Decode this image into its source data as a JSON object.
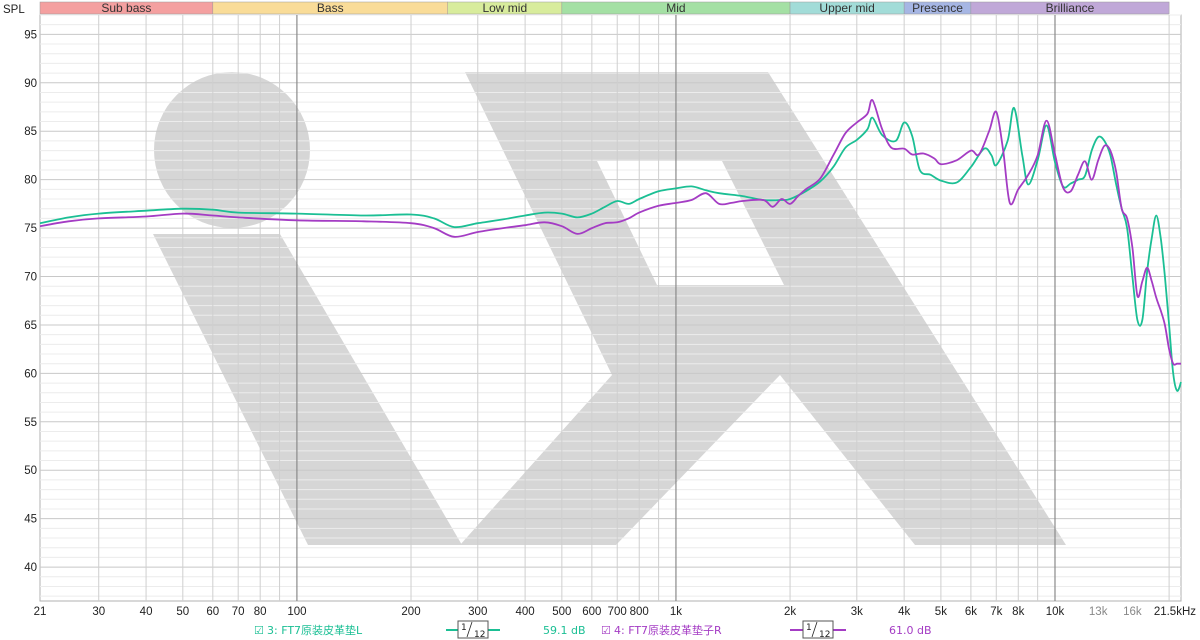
{
  "chart_data": {
    "type": "line",
    "ylabel": "SPL",
    "x_unit": "Hz",
    "ylim": [
      36.5,
      97
    ],
    "xlim": [
      21,
      21500
    ],
    "log_x": true,
    "grid": true,
    "y_ticks": [
      95,
      90,
      85,
      80,
      75,
      70,
      65,
      60,
      55,
      50,
      45,
      40
    ],
    "x_ticks": [
      {
        "v": 21,
        "label": "21"
      },
      {
        "v": 30,
        "label": "30"
      },
      {
        "v": 40,
        "label": "40"
      },
      {
        "v": 50,
        "label": "50"
      },
      {
        "v": 60,
        "label": "60"
      },
      {
        "v": 70,
        "label": "70"
      },
      {
        "v": 80,
        "label": "80"
      },
      {
        "v": 100,
        "label": "100"
      },
      {
        "v": 200,
        "label": "200"
      },
      {
        "v": 300,
        "label": "300"
      },
      {
        "v": 400,
        "label": "400"
      },
      {
        "v": 500,
        "label": "500"
      },
      {
        "v": 600,
        "label": "600"
      },
      {
        "v": 700,
        "label": "700"
      },
      {
        "v": 800,
        "label": "800"
      },
      {
        "v": 1000,
        "label": "1k"
      },
      {
        "v": 2000,
        "label": "2k"
      },
      {
        "v": 3000,
        "label": "3k"
      },
      {
        "v": 4000,
        "label": "4k"
      },
      {
        "v": 5000,
        "label": "5k"
      },
      {
        "v": 6000,
        "label": "6k"
      },
      {
        "v": 7000,
        "label": "7k"
      },
      {
        "v": 8000,
        "label": "8k"
      },
      {
        "v": 10000,
        "label": "10k"
      },
      {
        "v": 13000,
        "label": "13k",
        "dim": true
      },
      {
        "v": 16000,
        "label": "16k",
        "dim": true
      },
      {
        "v": 21500,
        "label": "21.5kHz"
      }
    ],
    "bands": [
      {
        "name": "Sub bass",
        "from": 21,
        "to": 60,
        "color": "#f4a0a0"
      },
      {
        "name": "Bass",
        "from": 60,
        "to": 250,
        "color": "#f9dc98"
      },
      {
        "name": "Low mid",
        "from": 250,
        "to": 500,
        "color": "#d8ec9c"
      },
      {
        "name": "Mid",
        "from": 500,
        "to": 2000,
        "color": "#a4e0a4"
      },
      {
        "name": "Upper mid",
        "from": 2000,
        "to": 4000,
        "color": "#a2dcd8"
      },
      {
        "name": "Presence",
        "from": 4000,
        "to": 6000,
        "color": "#a6b6e4"
      },
      {
        "name": "Brilliance",
        "from": 6000,
        "to": 20000,
        "color": "#c0a8d8"
      }
    ],
    "series": [
      {
        "name": "3: FT7原装皮革垫L",
        "color": "#1bbf94",
        "smoothing": "1/12",
        "level": "59.1 dB",
        "points": [
          [
            21,
            75.5
          ],
          [
            25,
            76.1
          ],
          [
            30,
            76.5
          ],
          [
            40,
            76.8
          ],
          [
            50,
            77.0
          ],
          [
            60,
            76.9
          ],
          [
            70,
            76.6
          ],
          [
            100,
            76.5
          ],
          [
            150,
            76.3
          ],
          [
            200,
            76.4
          ],
          [
            230,
            76.0
          ],
          [
            260,
            75.1
          ],
          [
            300,
            75.5
          ],
          [
            350,
            75.9
          ],
          [
            400,
            76.3
          ],
          [
            450,
            76.6
          ],
          [
            500,
            76.5
          ],
          [
            550,
            76.1
          ],
          [
            600,
            76.5
          ],
          [
            650,
            77.2
          ],
          [
            700,
            77.8
          ],
          [
            750,
            77.5
          ],
          [
            800,
            78.0
          ],
          [
            900,
            78.8
          ],
          [
            1000,
            79.1
          ],
          [
            1100,
            79.3
          ],
          [
            1200,
            78.9
          ],
          [
            1300,
            78.6
          ],
          [
            1500,
            78.3
          ],
          [
            1700,
            77.9
          ],
          [
            1900,
            77.9
          ],
          [
            2000,
            78.0
          ],
          [
            2200,
            78.8
          ],
          [
            2400,
            79.8
          ],
          [
            2600,
            81.3
          ],
          [
            2800,
            83.3
          ],
          [
            3000,
            84.1
          ],
          [
            3200,
            85.2
          ],
          [
            3300,
            86.4
          ],
          [
            3500,
            84.6
          ],
          [
            3800,
            84.0
          ],
          [
            4000,
            85.9
          ],
          [
            4200,
            84.5
          ],
          [
            4400,
            81.0
          ],
          [
            4700,
            80.5
          ],
          [
            5000,
            79.9
          ],
          [
            5500,
            79.7
          ],
          [
            6000,
            81.3
          ],
          [
            6500,
            83.2
          ],
          [
            6800,
            82.5
          ],
          [
            7000,
            81.5
          ],
          [
            7500,
            84.0
          ],
          [
            7800,
            87.4
          ],
          [
            8200,
            82.5
          ],
          [
            8500,
            79.5
          ],
          [
            9000,
            82.0
          ],
          [
            9500,
            85.6
          ],
          [
            10000,
            81.8
          ],
          [
            10500,
            79.3
          ],
          [
            11000,
            79.6
          ],
          [
            11500,
            80.0
          ],
          [
            12000,
            80.4
          ],
          [
            12500,
            83.0
          ],
          [
            13000,
            84.4
          ],
          [
            13500,
            84.0
          ],
          [
            14000,
            82.5
          ],
          [
            14500,
            79.5
          ],
          [
            15000,
            77.0
          ],
          [
            15500,
            75.0
          ],
          [
            16000,
            70.0
          ],
          [
            16500,
            65.5
          ],
          [
            17000,
            65.5
          ],
          [
            17500,
            70.5
          ],
          [
            18000,
            74.0
          ],
          [
            18500,
            76.3
          ],
          [
            19000,
            74.0
          ],
          [
            19500,
            70.0
          ],
          [
            20000,
            65.0
          ],
          [
            20500,
            60.0
          ],
          [
            21000,
            58.2
          ],
          [
            21500,
            59.1
          ]
        ]
      },
      {
        "name": "4: FT7原装皮革垫子R",
        "color": "#a43cc4",
        "smoothing": "1/12",
        "level": "61.0 dB",
        "points": [
          [
            21,
            75.2
          ],
          [
            25,
            75.7
          ],
          [
            30,
            76.0
          ],
          [
            40,
            76.2
          ],
          [
            50,
            76.5
          ],
          [
            60,
            76.3
          ],
          [
            70,
            76.1
          ],
          [
            100,
            75.8
          ],
          [
            150,
            75.7
          ],
          [
            200,
            75.5
          ],
          [
            230,
            75.0
          ],
          [
            260,
            74.1
          ],
          [
            300,
            74.6
          ],
          [
            350,
            75.0
          ],
          [
            400,
            75.3
          ],
          [
            450,
            75.6
          ],
          [
            500,
            75.2
          ],
          [
            550,
            74.4
          ],
          [
            600,
            75.0
          ],
          [
            650,
            75.5
          ],
          [
            700,
            75.6
          ],
          [
            750,
            76.0
          ],
          [
            800,
            76.6
          ],
          [
            900,
            77.3
          ],
          [
            1000,
            77.6
          ],
          [
            1100,
            77.9
          ],
          [
            1200,
            78.6
          ],
          [
            1300,
            77.5
          ],
          [
            1400,
            77.6
          ],
          [
            1500,
            77.8
          ],
          [
            1700,
            77.9
          ],
          [
            1800,
            77.2
          ],
          [
            1900,
            78.0
          ],
          [
            2000,
            77.5
          ],
          [
            2100,
            78.3
          ],
          [
            2200,
            79.0
          ],
          [
            2400,
            80.1
          ],
          [
            2600,
            82.5
          ],
          [
            2800,
            84.8
          ],
          [
            3000,
            85.9
          ],
          [
            3200,
            86.8
          ],
          [
            3300,
            88.2
          ],
          [
            3500,
            85.2
          ],
          [
            3700,
            83.3
          ],
          [
            4000,
            83.2
          ],
          [
            4200,
            82.6
          ],
          [
            4500,
            82.7
          ],
          [
            4800,
            82.2
          ],
          [
            5000,
            81.6
          ],
          [
            5500,
            82.0
          ],
          [
            6000,
            83.0
          ],
          [
            6300,
            82.6
          ],
          [
            6700,
            85.0
          ],
          [
            7000,
            87.0
          ],
          [
            7300,
            83.0
          ],
          [
            7600,
            77.6
          ],
          [
            8000,
            79.0
          ],
          [
            8500,
            80.5
          ],
          [
            9000,
            82.5
          ],
          [
            9500,
            86.1
          ],
          [
            10000,
            82.6
          ],
          [
            10500,
            79.2
          ],
          [
            11000,
            78.8
          ],
          [
            11500,
            80.5
          ],
          [
            12000,
            81.9
          ],
          [
            12500,
            80.0
          ],
          [
            13000,
            82.0
          ],
          [
            13500,
            83.5
          ],
          [
            14000,
            83.0
          ],
          [
            14500,
            80.8
          ],
          [
            15000,
            77.0
          ],
          [
            15500,
            76.0
          ],
          [
            16000,
            73.0
          ],
          [
            16500,
            68.0
          ],
          [
            17000,
            69.5
          ],
          [
            17500,
            70.9
          ],
          [
            18000,
            69.5
          ],
          [
            18500,
            67.8
          ],
          [
            19000,
            66.5
          ],
          [
            19500,
            65.0
          ],
          [
            20000,
            62.5
          ],
          [
            20500,
            61.0
          ],
          [
            21000,
            61.0
          ],
          [
            21500,
            61.0
          ]
        ]
      }
    ]
  },
  "legend": {
    "items": [
      {
        "checkbox": "☑",
        "label": "3: FT7原装皮革垫L",
        "smoothing_num": "1",
        "smoothing_den": "12",
        "level": "59.1 dB",
        "color": "#1bbf94"
      },
      {
        "checkbox": "☑",
        "label": "4: FT7原装皮革垫子R",
        "smoothing_num": "1",
        "smoothing_den": "12",
        "level": "61.0 dB",
        "color": "#a43cc4"
      }
    ]
  }
}
